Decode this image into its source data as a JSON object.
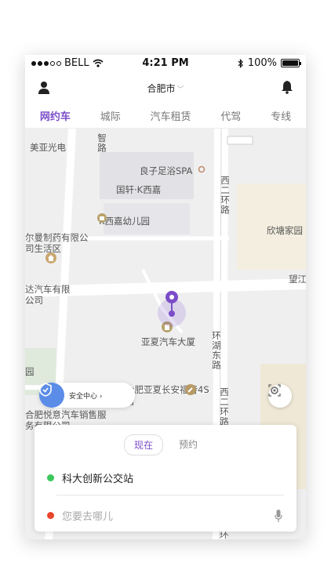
{
  "status": {
    "carrier": "BELL",
    "time": "4:21 PM",
    "battery": "100%",
    "battery_level": 1.0
  },
  "header": {
    "city": "合肥市"
  },
  "tabs": [
    {
      "label": "网约车",
      "active": true
    },
    {
      "label": "城际",
      "active": false
    },
    {
      "label": "汽车租赁",
      "active": false
    },
    {
      "label": "代驾",
      "active": false
    },
    {
      "label": "专线",
      "active": false
    }
  ],
  "map": {
    "labels": {
      "meiya": "美亚光电",
      "zhi_road": "智路",
      "liangzi": "良子足浴SPA",
      "guoxuan": "国轩·K西嘉",
      "kindergarten": "K西嘉幼儿园",
      "pharma": "尔曼制药有限公司生活区",
      "xier_road": "西二环路",
      "xintang": "欣塘家园",
      "wang": "望江",
      "auto": "达汽车有限公司",
      "yaxia": "亚夏汽车大厦",
      "huanhu": "环湖东路",
      "hefei_4s": "合肥亚夏长安福特4S店",
      "xier_road2": "西二环路",
      "yueyi": "合肥悦意汽车销售服务有限公司",
      "yuan": "园",
      "huan": "环"
    },
    "safety_label": "安全中心"
  },
  "card": {
    "options": [
      "现在",
      "预约"
    ],
    "pickup": "科大创新公交站",
    "destination_placeholder": "您要去哪儿"
  },
  "colors": {
    "accent": "#7b4dc9",
    "pickup_dot": "#3cc85a",
    "dest_dot": "#e8452c",
    "shield": "#5b8de8"
  }
}
